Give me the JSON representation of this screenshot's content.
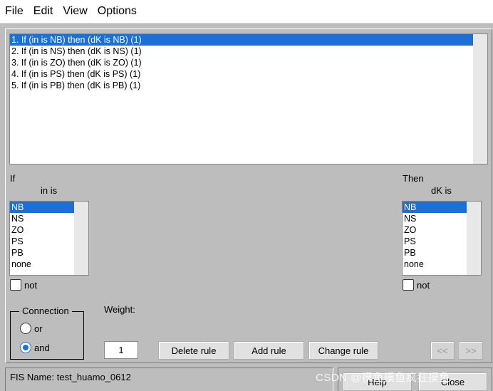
{
  "menu": [
    "File",
    "Edit",
    "View",
    "Options"
  ],
  "rules": [
    "1. If (in is NB) then (dK is NB) (1)",
    "2. If (in is NS) then (dK is NS) (1)",
    "3. If (in is ZO) then (dK is ZO) (1)",
    "4. If (in is PS) then (dK is PS) (1)",
    "5. If (in is PB) then (dK is PB) (1)"
  ],
  "if_section": {
    "label": "If",
    "var_label": "in is",
    "options": [
      "NB",
      "NS",
      "ZO",
      "PS",
      "PB",
      "none"
    ],
    "selected": "NB",
    "not_label": "not"
  },
  "then_section": {
    "label": "Then",
    "var_label": "dK is",
    "options": [
      "NB",
      "NS",
      "ZO",
      "PS",
      "PB",
      "none"
    ],
    "selected": "NB",
    "not_label": "not"
  },
  "connection": {
    "title": "Connection",
    "or_label": "or",
    "and_label": "and",
    "selected": "and"
  },
  "weight": {
    "label": "Weight:",
    "value": "1"
  },
  "buttons": {
    "delete": "Delete rule",
    "add": "Add rule",
    "change": "Change rule",
    "prev": "<<",
    "next": ">>",
    "help": "Help",
    "close": "Close"
  },
  "status": {
    "fis_name": "FIS Name: test_huamo_0612"
  },
  "watermark": "CSDN @摸鱼摸鱼疯狂摸鱼",
  "colors": {
    "background": "#bdbdbd",
    "selection": "#1c6fd4"
  }
}
